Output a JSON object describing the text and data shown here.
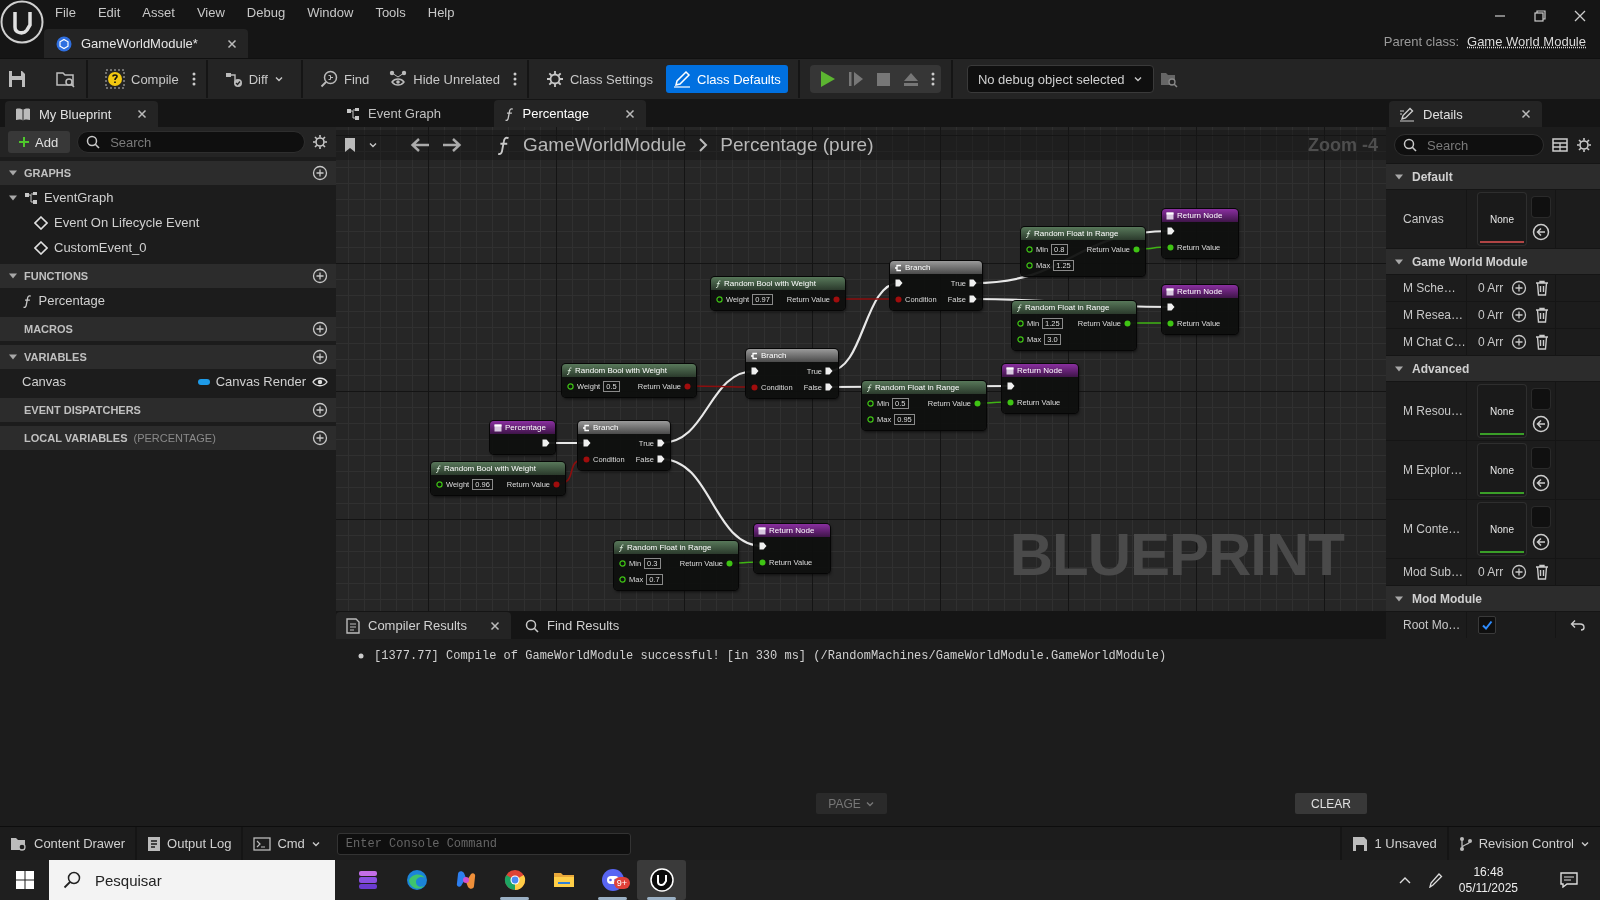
{
  "menu": [
    "File",
    "Edit",
    "Asset",
    "View",
    "Debug",
    "Window",
    "Tools",
    "Help"
  ],
  "document_tab": {
    "title": "GameWorldModule*"
  },
  "parent_class": {
    "label": "Parent class:",
    "value": "Game World Module"
  },
  "toolbar": {
    "compile": "Compile",
    "diff": "Diff",
    "find": "Find",
    "hide_unrelated": "Hide Unrelated",
    "modes": [
      {
        "label": "Class Settings",
        "selected": false
      },
      {
        "label": "Class Defaults",
        "selected": true
      }
    ],
    "debug_object": "No debug object selected"
  },
  "my_blueprint": {
    "tab": "My Blueprint",
    "add": "Add",
    "search": {
      "placeholder": "Search"
    },
    "sections": [
      {
        "title": "GRAPHS",
        "items": [
          {
            "label": "EventGraph",
            "kind": "graph",
            "children": [
              {
                "label": "Event On Lifecycle Event",
                "kind": "event"
              },
              {
                "label": "CustomEvent_0",
                "kind": "event"
              }
            ]
          }
        ]
      },
      {
        "title": "FUNCTIONS",
        "items": [
          {
            "label": "Percentage",
            "kind": "function"
          }
        ]
      },
      {
        "title": "MACROS"
      },
      {
        "title": "VARIABLES",
        "items": [
          {
            "label": "Canvas",
            "kind": "variable",
            "type": "Canvas Render"
          }
        ]
      },
      {
        "title": "EVENT DISPATCHERS"
      },
      {
        "title": "LOCAL VARIABLES",
        "subtitle": "(PERCENTAGE)"
      }
    ]
  },
  "graph_tabs": [
    {
      "label": "Event Graph",
      "selected": false
    },
    {
      "label": "Percentage",
      "selected": true
    }
  ],
  "breadcrumb": [
    "GameWorldModule",
    "Percentage (pure)"
  ],
  "zoom": "Zoom -4",
  "graph_label": "BLUEPRINT",
  "nodes": [
    {
      "kind": "function",
      "title": "Random Float in Range",
      "rows": [
        {
          "in": {
            "kind": "float",
            "label": "Min",
            "value": "0.8"
          },
          "out": {
            "kind": "float",
            "label": "Return Value"
          }
        },
        {
          "in": {
            "kind": "float",
            "label": "Max",
            "value": "1.25"
          }
        }
      ]
    },
    {
      "kind": "return",
      "title": "Return Node",
      "rows": [
        {
          "in": {
            "kind": "exec"
          }
        },
        {
          "in": {
            "kind": "float",
            "label": "Return Value"
          }
        }
      ]
    },
    {
      "kind": "function",
      "title": "Random Bool with Weight",
      "rows": [
        {
          "in": {
            "kind": "float",
            "label": "Weight",
            "value": "0.97"
          },
          "out": {
            "kind": "bool",
            "label": "Return Value"
          }
        }
      ]
    },
    {
      "kind": "branch",
      "title": "Branch",
      "rows": [
        {
          "in": {
            "kind": "exec"
          },
          "out": {
            "kind": "exec",
            "label": "True"
          }
        },
        {
          "in": {
            "kind": "bool",
            "label": "Condition"
          },
          "out": {
            "kind": "exec",
            "label": "False"
          }
        }
      ]
    },
    {
      "kind": "function",
      "title": "Random Float in Range",
      "rows": [
        {
          "in": {
            "kind": "float",
            "label": "Min",
            "value": "1.25"
          },
          "out": {
            "kind": "float",
            "label": "Return Value"
          }
        },
        {
          "in": {
            "kind": "float",
            "label": "Max",
            "value": "3.0"
          }
        }
      ]
    },
    {
      "kind": "return",
      "title": "Return Node",
      "rows": [
        {
          "in": {
            "kind": "exec"
          }
        },
        {
          "in": {
            "kind": "float",
            "label": "Return Value"
          }
        }
      ]
    },
    {
      "kind": "function",
      "title": "Random Bool with Weight",
      "rows": [
        {
          "in": {
            "kind": "float",
            "label": "Weight",
            "value": "0.5"
          },
          "out": {
            "kind": "bool",
            "label": "Return Value"
          }
        }
      ]
    },
    {
      "kind": "branch",
      "title": "Branch",
      "rows": [
        {
          "in": {
            "kind": "exec"
          },
          "out": {
            "kind": "exec",
            "label": "True"
          }
        },
        {
          "in": {
            "kind": "bool",
            "label": "Condition"
          },
          "out": {
            "kind": "exec",
            "label": "False"
          }
        }
      ]
    },
    {
      "kind": "function",
      "title": "Random Float in Range",
      "rows": [
        {
          "in": {
            "kind": "float",
            "label": "Min",
            "value": "0.5"
          },
          "out": {
            "kind": "float",
            "label": "Return Value"
          }
        },
        {
          "in": {
            "kind": "float",
            "label": "Max",
            "value": "0.95"
          }
        }
      ]
    },
    {
      "kind": "return",
      "title": "Return Node",
      "rows": [
        {
          "in": {
            "kind": "exec"
          }
        },
        {
          "in": {
            "kind": "float",
            "label": "Return Value"
          }
        }
      ]
    },
    {
      "kind": "entry",
      "title": "Percentage",
      "rows": [
        {
          "out": {
            "kind": "exec"
          }
        }
      ]
    },
    {
      "kind": "branch",
      "title": "Branch",
      "rows": [
        {
          "in": {
            "kind": "exec"
          },
          "out": {
            "kind": "exec",
            "label": "True"
          }
        },
        {
          "in": {
            "kind": "bool",
            "label": "Condition"
          },
          "out": {
            "kind": "exec",
            "label": "False"
          }
        }
      ]
    },
    {
      "kind": "function",
      "title": "Random Bool with Weight",
      "rows": [
        {
          "in": {
            "kind": "float",
            "label": "Weight",
            "value": "0.96"
          },
          "out": {
            "kind": "bool",
            "label": "Return Value"
          }
        }
      ]
    },
    {
      "kind": "function",
      "title": "Random Float in Range",
      "rows": [
        {
          "in": {
            "kind": "float",
            "label": "Min",
            "value": "0.3"
          },
          "out": {
            "kind": "float",
            "label": "Return Value"
          }
        },
        {
          "in": {
            "kind": "float",
            "label": "Max",
            "value": "0.7"
          }
        }
      ]
    },
    {
      "kind": "return",
      "title": "Return Node",
      "rows": [
        {
          "in": {
            "kind": "exec"
          }
        },
        {
          "in": {
            "kind": "float",
            "label": "Return Value"
          }
        }
      ]
    }
  ],
  "results": {
    "tabs": [
      {
        "label": "Compiler Results",
        "selected": true
      },
      {
        "label": "Find Results",
        "selected": false
      }
    ],
    "messages": [
      "[1377.77] Compile of GameWorldModule successful! [in 330 ms] (/RandomMachines/GameWorldModule.GameWorldModule)"
    ],
    "page": "PAGE",
    "clear": "CLEAR"
  },
  "details": {
    "tab": "Details",
    "search": {
      "placeholder": "Search"
    },
    "categories": [
      {
        "title": "Default",
        "rows": [
          {
            "label": "Canvas",
            "kind": "object",
            "value": "None",
            "color": "#b04545"
          }
        ]
      },
      {
        "title": "Game World Module",
        "rows": [
          {
            "label": "M Sche…",
            "kind": "array",
            "value": "0 Arr"
          },
          {
            "label": "M Resea…",
            "kind": "array",
            "value": "0 Arr"
          },
          {
            "label": "M Chat C…",
            "kind": "array",
            "value": "0 Arr"
          }
        ]
      },
      {
        "title": "Advanced",
        "rows": [
          {
            "label": "M Resou…",
            "kind": "object",
            "value": "None",
            "color": "#3a9e28"
          },
          {
            "label": "M Explor…",
            "kind": "object",
            "value": "None",
            "color": "#3a9e28"
          },
          {
            "label": "M Conte…",
            "kind": "object",
            "value": "None",
            "color": "#3a9e28"
          },
          {
            "label": "Mod Sub…",
            "kind": "array",
            "value": "0 Arr"
          }
        ]
      },
      {
        "title": "Mod Module",
        "rows": [
          {
            "label": "Root Mo…",
            "kind": "bool",
            "checked": true
          }
        ]
      }
    ]
  },
  "status_bar": {
    "content_drawer": "Content Drawer",
    "output_log": "Output Log",
    "cmd": "Cmd",
    "console": {
      "placeholder": "Enter Console Command"
    },
    "unsaved": "1 Unsaved",
    "revision_control": "Revision Control"
  },
  "taskbar": {
    "search": {
      "placeholder": "Pesquisar"
    },
    "apps": [
      {
        "running": false,
        "selected": false
      },
      {
        "running": false,
        "selected": false
      },
      {
        "running": false,
        "selected": false
      },
      {
        "running": true,
        "selected": false
      },
      {
        "running": false,
        "selected": false
      },
      {
        "running": true,
        "selected": false,
        "badge": "9+"
      },
      {
        "running": true,
        "selected": true
      }
    ],
    "time": "16:48",
    "date": "05/11/2025"
  }
}
